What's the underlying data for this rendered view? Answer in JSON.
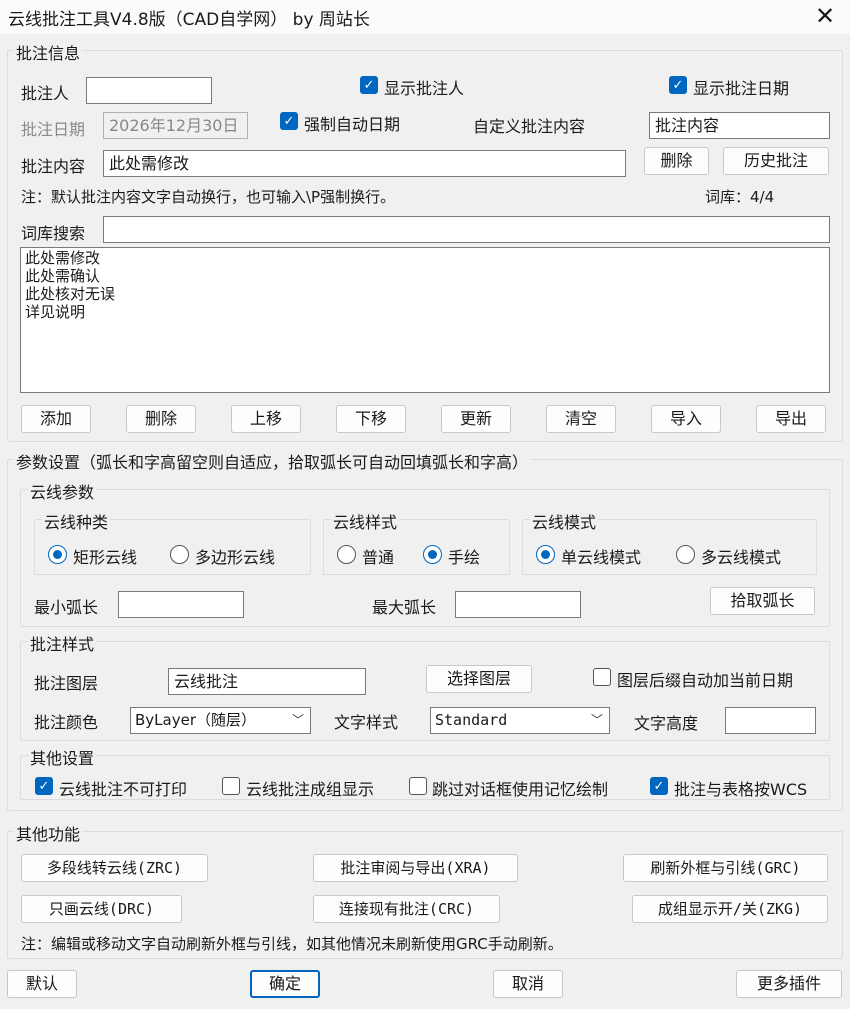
{
  "window": {
    "title": "云线批注工具V4.8版（CAD自学网） by 周站长",
    "close_glyph": "✕"
  },
  "annot_info": {
    "legend": "批注信息",
    "annotator_label": "批注人",
    "annotator_value": "",
    "show_annotator_label": "显示批注人",
    "show_annotator_checked": true,
    "show_date_label": "显示批注日期",
    "show_date_checked": true,
    "date_label": "批注日期",
    "date_value": "2026年12月30日",
    "force_auto_date_label": "强制自动日期",
    "force_auto_date_checked": true,
    "custom_content_label": "自定义批注内容",
    "custom_content_value": "批注内容",
    "content_label": "批注内容",
    "content_value": "此处需修改",
    "delete_button": "删除",
    "history_button": "历史批注",
    "note": "注：默认批注内容文字自动换行，也可输入\\P强制换行。",
    "lexicon_count": "词库：4/4",
    "search_label": "词库搜索",
    "search_value": "",
    "lexicon_items": [
      "此处需修改",
      "此处需确认",
      "此处核对无误",
      "详见说明"
    ],
    "buttons": [
      "添加",
      "删除",
      "上移",
      "下移",
      "更新",
      "清空",
      "导入",
      "导出"
    ]
  },
  "params": {
    "legend": "参数设置（弧长和字高留空则自适应，拾取弧长可自动回填弧长和字高）",
    "cloud_params_legend": "云线参数",
    "kind_legend": "云线种类",
    "kind_options": [
      "矩形云线",
      "多边形云线"
    ],
    "kind_selected": 0,
    "style_legend": "云线样式",
    "style_options": [
      "普通",
      "手绘"
    ],
    "style_selected": 1,
    "mode_legend": "云线模式",
    "mode_options": [
      "单云线模式",
      "多云线模式"
    ],
    "mode_selected": 0,
    "min_arc_label": "最小弧长",
    "min_arc_value": "",
    "max_arc_label": "最大弧长",
    "max_arc_value": "",
    "pick_arc_button": "拾取弧长",
    "annot_style_legend": "批注样式",
    "layer_label": "批注图层",
    "layer_value": "云线批注",
    "select_layer_button": "选择图层",
    "layer_suffix_label": "图层后缀自动加当前日期",
    "layer_suffix_checked": false,
    "color_label": "批注颜色",
    "color_value": "ByLayer（随层）",
    "text_style_label": "文字样式",
    "text_style_value": "Standard",
    "text_height_label": "文字高度",
    "text_height_value": "",
    "other_settings_legend": "其他设置",
    "other_settings": [
      {
        "label": "云线批注不可打印",
        "checked": true
      },
      {
        "label": "云线批注成组显示",
        "checked": false
      },
      {
        "label": "跳过对话框使用记忆绘制",
        "checked": false
      },
      {
        "label": "批注与表格按WCS",
        "checked": true
      }
    ]
  },
  "functions": {
    "legend": "其他功能",
    "buttons": [
      "多段线转云线(ZRC)",
      "批注审阅与导出(XRA)",
      "刷新外框与引线(GRC)",
      "只画云线(DRC)",
      "连接现有批注(CRC)",
      "成组显示开/关(ZKG)"
    ],
    "note": "注：编辑或移动文字自动刷新外框与引线，如其他情况未刷新使用GRC手动刷新。"
  },
  "footer": {
    "default_button": "默认",
    "ok_button": "确定",
    "cancel_button": "取消",
    "more_button": "更多插件"
  },
  "colors": {
    "accent": "#0067c0",
    "window_bg": "#f0f0f0",
    "titlebar_bg": "#fbfbfb"
  }
}
